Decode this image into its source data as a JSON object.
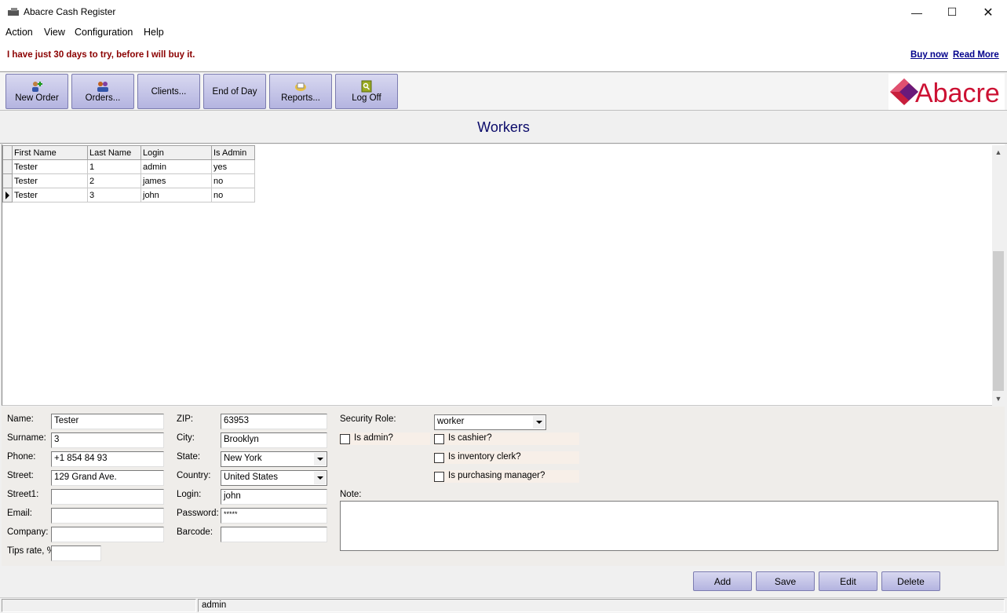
{
  "window": {
    "title": "Abacre Cash Register",
    "minimize_icon": "minimize-icon",
    "maximize_icon": "maximize-icon",
    "close_icon": "close-icon"
  },
  "menu": [
    "Action",
    "View",
    "Configuration",
    "Help"
  ],
  "promo": {
    "trial_text": "I have just 30 days to try, before I will buy it.",
    "buy_now": "Buy now",
    "read_more": "Read More"
  },
  "toolbar": [
    {
      "label": "New Order",
      "icon": "new-order-icon"
    },
    {
      "label": "Orders...",
      "icon": "orders-icon"
    },
    {
      "label": "Clients...",
      "icon": ""
    },
    {
      "label": "End of Day",
      "icon": ""
    },
    {
      "label": "Reports...",
      "icon": "reports-icon"
    },
    {
      "label": "Log Off",
      "icon": "log-off-icon"
    }
  ],
  "logo": {
    "text": "Abacre",
    "color": "#cc1133"
  },
  "page_title": "Workers",
  "grid": {
    "columns": [
      "First Name",
      "Last Name",
      "Login",
      "Is Admin"
    ],
    "rows": [
      [
        "Tester",
        "1",
        "admin",
        "yes"
      ],
      [
        "Tester",
        "2",
        "james",
        "no"
      ],
      [
        "Tester",
        "3",
        "john",
        "no"
      ]
    ],
    "selected_row": 2
  },
  "form": {
    "name_label": "Name:",
    "name": "Tester",
    "surname_label": "Surname:",
    "surname": "3",
    "phone_label": "Phone:",
    "phone": "+1 854 84 93",
    "street_label": "Street:",
    "street": "129 Grand Ave.",
    "street1_label": "Street1:",
    "street1": "",
    "email_label": "Email:",
    "email": "",
    "company_label": "Company:",
    "company": "",
    "tips_label": "Tips rate, %",
    "tips": "",
    "zip_label": "ZIP:",
    "zip": "63953",
    "city_label": "City:",
    "city": "Brooklyn",
    "state_label": "State:",
    "state": "New York",
    "country_label": "Country:",
    "country": "United States",
    "login_label": "Login:",
    "login": "john",
    "password_label": "Password:",
    "password": "*****",
    "barcode_label": "Barcode:",
    "barcode": "",
    "security_role_label": "Security Role:",
    "security_role": "worker",
    "is_admin_label": "Is admin?",
    "is_cashier_label": "Is cashier?",
    "is_inventory_label": "Is inventory clerk?",
    "is_purchasing_label": "Is purchasing manager?",
    "note_label": "Note:",
    "note": ""
  },
  "actions": {
    "add": "Add",
    "save": "Save",
    "edit": "Edit",
    "delete": "Delete"
  },
  "status": {
    "user": "admin"
  }
}
